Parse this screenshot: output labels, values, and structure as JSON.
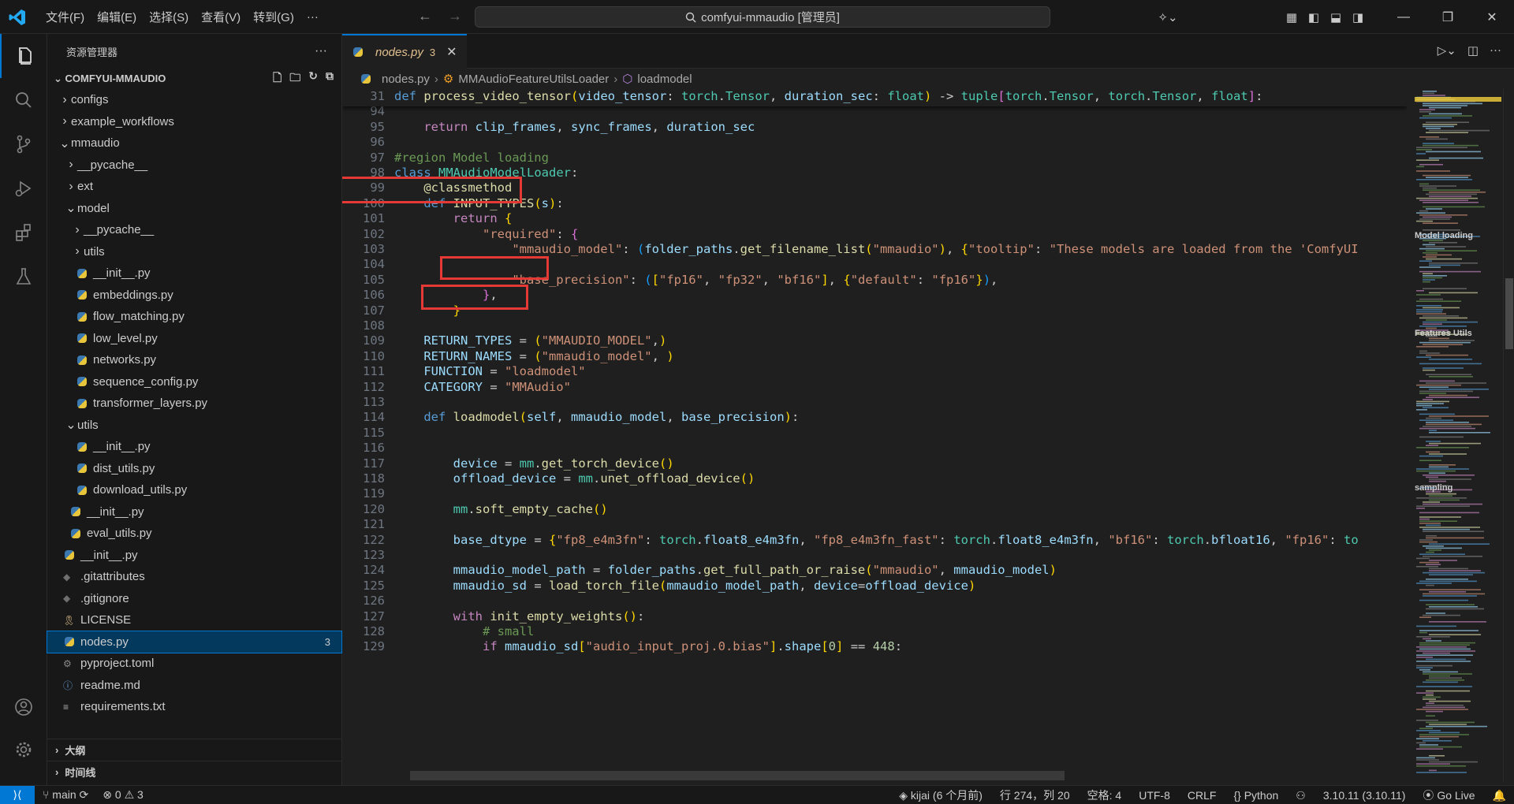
{
  "titlebar": {
    "menus": [
      "文件(F)",
      "编辑(E)",
      "选择(S)",
      "查看(V)",
      "转到(G)",
      "···"
    ],
    "search": "comfyui-mmaudio [管理员]"
  },
  "sidebar": {
    "title": "资源管理器",
    "more": "···",
    "project": "COMFYUI-MMAUDIO",
    "tree": [
      {
        "label": "configs",
        "type": "folder",
        "open": false,
        "depth": 0
      },
      {
        "label": "example_workflows",
        "type": "folder",
        "open": false,
        "depth": 0
      },
      {
        "label": "mmaudio",
        "type": "folder",
        "open": true,
        "depth": 0
      },
      {
        "label": "__pycache__",
        "type": "folder",
        "open": false,
        "depth": 1
      },
      {
        "label": "ext",
        "type": "folder",
        "open": false,
        "depth": 1
      },
      {
        "label": "model",
        "type": "folder",
        "open": true,
        "depth": 1
      },
      {
        "label": "__pycache__",
        "type": "folder",
        "open": false,
        "depth": 2
      },
      {
        "label": "utils",
        "type": "folder",
        "open": false,
        "depth": 2
      },
      {
        "label": "__init__.py",
        "type": "py",
        "depth": 2
      },
      {
        "label": "embeddings.py",
        "type": "py",
        "depth": 2
      },
      {
        "label": "flow_matching.py",
        "type": "py",
        "depth": 2
      },
      {
        "label": "low_level.py",
        "type": "py",
        "depth": 2
      },
      {
        "label": "networks.py",
        "type": "py",
        "depth": 2
      },
      {
        "label": "sequence_config.py",
        "type": "py",
        "depth": 2
      },
      {
        "label": "transformer_layers.py",
        "type": "py",
        "depth": 2
      },
      {
        "label": "utils",
        "type": "folder",
        "open": true,
        "depth": 1
      },
      {
        "label": "__init__.py",
        "type": "py",
        "depth": 2
      },
      {
        "label": "dist_utils.py",
        "type": "py",
        "depth": 2
      },
      {
        "label": "download_utils.py",
        "type": "py",
        "depth": 2
      },
      {
        "label": "__init__.py",
        "type": "py",
        "depth": 1
      },
      {
        "label": "eval_utils.py",
        "type": "py",
        "depth": 1
      },
      {
        "label": "__init__.py",
        "type": "py",
        "depth": 0
      },
      {
        "label": ".gitattributes",
        "type": "git",
        "depth": 0
      },
      {
        "label": ".gitignore",
        "type": "git",
        "depth": 0
      },
      {
        "label": "LICENSE",
        "type": "license",
        "depth": 0
      },
      {
        "label": "nodes.py",
        "type": "py",
        "depth": 0,
        "selected": true,
        "badge": "3"
      },
      {
        "label": "pyproject.toml",
        "type": "gear",
        "depth": 0
      },
      {
        "label": "readme.md",
        "type": "info",
        "depth": 0
      },
      {
        "label": "requirements.txt",
        "type": "txt",
        "depth": 0
      }
    ],
    "outline": "大纲",
    "timeline": "时间线"
  },
  "editor": {
    "tab": {
      "label": "nodes.py",
      "problems": "3"
    },
    "breadcrumb": [
      "nodes.py",
      "MMAudioFeatureUtilsLoader",
      "loadmodel"
    ],
    "minimap_labels": [
      "Model loading",
      "Features Utils",
      "sampling"
    ]
  },
  "statusbar": {
    "branch": "main",
    "errors": "0",
    "warnings": "3",
    "blame": "kijai (6 个月前)",
    "position": "行 274，列 20",
    "indent": "空格: 4",
    "encoding": "UTF-8",
    "eol": "CRLF",
    "language": "Python",
    "python": "3.10.11 (3.10.11)",
    "golive": "Go Live"
  },
  "code": [
    {
      "n": "31",
      "sticky": true,
      "html": "<span class='kw'>def</span> <span class='fn'>process_video_tensor</span><span class='br1'>(</span><span class='var'>video_tensor</span>: <span class='cls'>torch</span>.<span class='cls'>Tensor</span>, <span class='var'>duration_sec</span>: <span class='cls'>float</span><span class='br1'>)</span> -> <span class='cls'>tuple</span><span class='br2'>[</span><span class='cls'>torch</span>.<span class='cls'>Tensor</span>, <span class='cls'>torch</span>.<span class='cls'>Tensor</span>, <span class='cls'>float</span><span class='br2'>]</span>:"
    },
    {
      "n": "94",
      "html": ""
    },
    {
      "n": "95",
      "html": "    <span class='kw2'>return</span> <span class='var'>clip_frames</span>, <span class='var'>sync_frames</span>, <span class='var'>duration_sec</span>"
    },
    {
      "n": "96",
      "html": ""
    },
    {
      "n": "97",
      "html": "<span class='cm'>#region Model loading</span>"
    },
    {
      "n": "98",
      "html": "<span class='kw'>class</span> <span class='cls'>MMAudioModelLoader</span>:"
    },
    {
      "n": "99",
      "html": "    <span class='dec'>@classmethod</span>"
    },
    {
      "n": "100",
      "html": "    <span class='kw'>def</span> <span class='fn'>INPUT_TYPES</span><span class='br1'>(</span><span class='var'>s</span><span class='br1'>)</span>:"
    },
    {
      "n": "101",
      "html": "        <span class='kw2'>return</span> <span class='br1'>{</span>"
    },
    {
      "n": "102",
      "html": "            <span class='str'>\"required\"</span>: <span class='br2'>{</span>"
    },
    {
      "n": "103",
      "html": "                <span class='str'>\"mmaudio_model\"</span>: <span class='br3'>(</span><span class='var'>folder_paths</span>.<span class='fn'>get_filename_list</span><span class='br1'>(</span><span class='str'>\"mmaudio\"</span><span class='br1'>)</span>, <span class='br1'>{</span><span class='str'>\"tooltip\"</span>: <span class='str'>\"These models are loaded from the 'ComfyUI</span>"
    },
    {
      "n": "104",
      "html": ""
    },
    {
      "n": "105",
      "html": "                <span class='str'>\"base_precision\"</span>: <span class='br3'>(</span><span class='br1'>[</span><span class='str'>\"fp16\"</span>, <span class='str'>\"fp32\"</span>, <span class='str'>\"bf16\"</span><span class='br1'>]</span>, <span class='br1'>{</span><span class='str'>\"default\"</span>: <span class='str'>\"fp16\"</span><span class='br1'>}</span><span class='br3'>)</span>,"
    },
    {
      "n": "106",
      "html": "            <span class='br2'>}</span>,"
    },
    {
      "n": "107",
      "html": "        <span class='br1'>}</span>"
    },
    {
      "n": "108",
      "html": ""
    },
    {
      "n": "109",
      "html": "    <span class='var'>RETURN_TYPES</span> = <span class='br1'>(</span><span class='str'>\"MMAUDIO_MODEL\"</span>,<span class='br1'>)</span>"
    },
    {
      "n": "110",
      "html": "    <span class='var'>RETURN_NAMES</span> = <span class='br1'>(</span><span class='str'>\"mmaudio_model\"</span>, <span class='br1'>)</span>"
    },
    {
      "n": "111",
      "html": "    <span class='var'>FUNCTION</span> = <span class='str'>\"loadmodel\"</span>"
    },
    {
      "n": "112",
      "html": "    <span class='var'>CATEGORY</span> = <span class='str'>\"MMAudio\"</span>"
    },
    {
      "n": "113",
      "html": ""
    },
    {
      "n": "114",
      "html": "    <span class='kw'>def</span> <span class='fn'>loadmodel</span><span class='br1'>(</span><span class='var'>self</span>, <span class='var'>mmaudio_model</span>, <span class='var'>base_precision</span><span class='br1'>)</span>:"
    },
    {
      "n": "115",
      "html": ""
    },
    {
      "n": "116",
      "html": ""
    },
    {
      "n": "117",
      "html": "        <span class='var'>device</span> = <span class='cls'>mm</span>.<span class='fn'>get_torch_device</span><span class='br1'>()</span>"
    },
    {
      "n": "118",
      "html": "        <span class='var'>offload_device</span> = <span class='cls'>mm</span>.<span class='fn'>unet_offload_device</span><span class='br1'>()</span>"
    },
    {
      "n": "119",
      "html": ""
    },
    {
      "n": "120",
      "html": "        <span class='cls'>mm</span>.<span class='fn'>soft_empty_cache</span><span class='br1'>()</span>"
    },
    {
      "n": "121",
      "html": ""
    },
    {
      "n": "122",
      "html": "        <span class='var'>base_dtype</span> = <span class='br1'>{</span><span class='str'>\"fp8_e4m3fn\"</span>: <span class='cls'>torch</span>.<span class='var'>float8_e4m3fn</span>, <span class='str'>\"fp8_e4m3fn_fast\"</span>: <span class='cls'>torch</span>.<span class='var'>float8_e4m3fn</span>, <span class='str'>\"bf16\"</span>: <span class='cls'>torch</span>.<span class='var'>bfloat16</span>, <span class='str'>\"fp16\"</span>: <span class='cls'>to</span>"
    },
    {
      "n": "123",
      "html": ""
    },
    {
      "n": "124",
      "html": "        <span class='var'>mmaudio_model_path</span> = <span class='var'>folder_paths</span>.<span class='fn'>get_full_path_or_raise</span><span class='br1'>(</span><span class='str'>\"mmaudio\"</span>, <span class='var'>mmaudio_model</span><span class='br1'>)</span>"
    },
    {
      "n": "125",
      "html": "        <span class='var'>mmaudio_sd</span> = <span class='fn'>load_torch_file</span><span class='br1'>(</span><span class='var'>mmaudio_model_path</span>, <span class='var'>device</span>=<span class='var'>offload_device</span><span class='br1'>)</span>"
    },
    {
      "n": "126",
      "html": ""
    },
    {
      "n": "127",
      "html": "        <span class='kw2'>with</span> <span class='fn'>init_empty_weights</span><span class='br1'>()</span>:"
    },
    {
      "n": "128",
      "html": "            <span class='cm'># small</span>"
    },
    {
      "n": "129",
      "html": "            <span class='kw2'>if</span> <span class='var'>mmaudio_sd</span><span class='br1'>[</span><span class='str'>\"audio_input_proj.0.bias\"</span><span class='br1'>]</span>.<span class='var'>shape</span><span class='br1'>[</span><span class='num'>0</span><span class='br1'>]</span> == <span class='num'>448</span>:"
    }
  ]
}
